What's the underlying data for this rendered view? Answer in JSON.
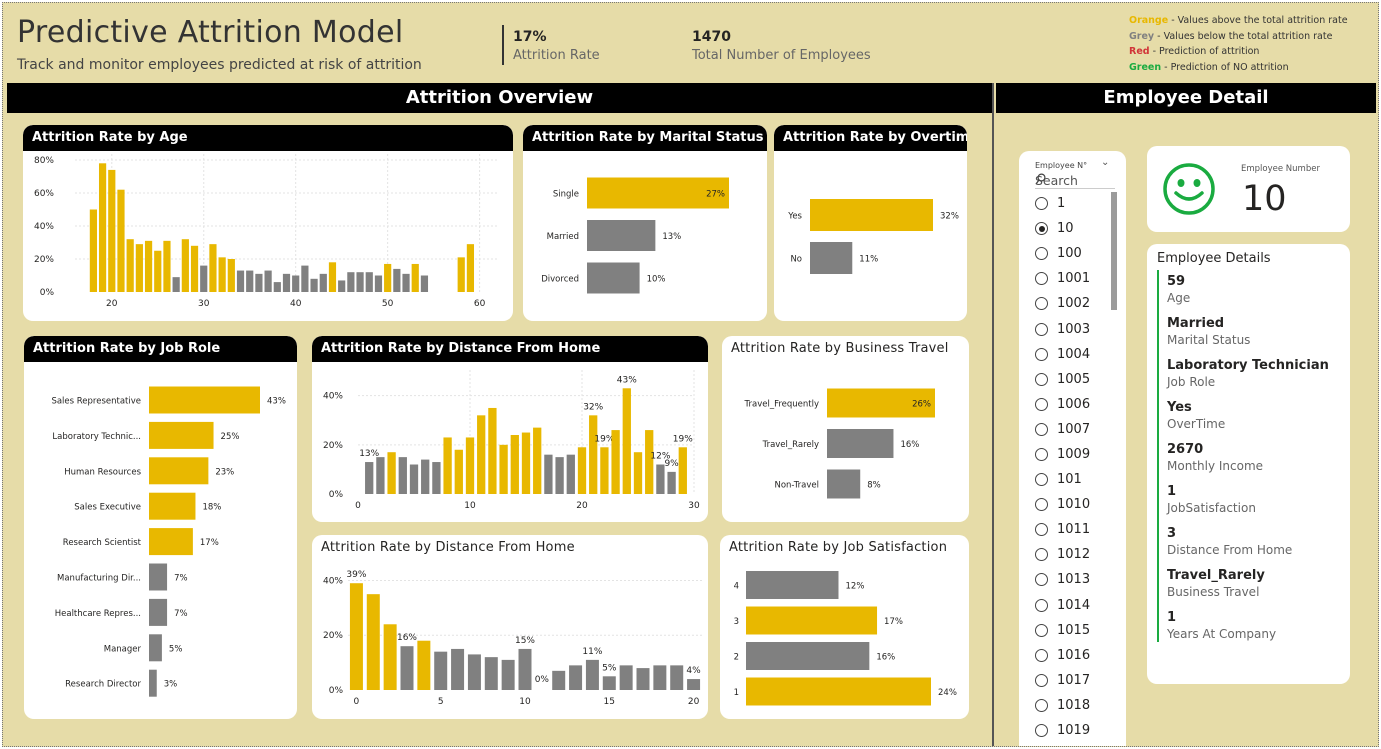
{
  "header": {
    "title": "Predictive Attrition Model",
    "subtitle": "Track and monitor employees predicted at risk of attrition",
    "kpis": [
      {
        "value": "17%",
        "label": "Attrition Rate"
      },
      {
        "value": "1470",
        "label": "Total Number of Employees"
      }
    ],
    "legend": [
      {
        "key": "Orange",
        "text": " - Values above the total attrition rate",
        "color": "#e8b800"
      },
      {
        "key": "Grey",
        "text": " - Values below the total attrition rate",
        "color": "#808080"
      },
      {
        "key": "Red",
        "text": " - Prediction of attrition",
        "color": "#d13438"
      },
      {
        "key": "Green",
        "text": " - Prediction of NO attrition",
        "color": "#1aab40"
      }
    ]
  },
  "banners": {
    "overview": "Attrition Overview",
    "detail": "Employee Detail"
  },
  "colors": {
    "above": "#e8b800",
    "below": "#808080",
    "background": "#e6dca8",
    "smiley": "#1aab40"
  },
  "chart_data": [
    {
      "id": "age",
      "type": "bar",
      "title": "Attrition Rate by Age",
      "x": [
        18,
        19,
        20,
        21,
        22,
        23,
        24,
        25,
        26,
        27,
        28,
        29,
        30,
        31,
        32,
        33,
        34,
        35,
        36,
        37,
        38,
        39,
        40,
        41,
        42,
        43,
        44,
        45,
        46,
        47,
        48,
        49,
        50,
        51,
        52,
        53,
        54,
        55,
        56,
        57,
        58,
        59,
        60
      ],
      "values": [
        50,
        78,
        74,
        62,
        32,
        29,
        31,
        25,
        31,
        9,
        32,
        28,
        16,
        29,
        21,
        20,
        13,
        13,
        11,
        13,
        6,
        11,
        10,
        16,
        8,
        11,
        18,
        7,
        12,
        12,
        12,
        10,
        17,
        14,
        11,
        17,
        10,
        0,
        0,
        0,
        21,
        29,
        0
      ],
      "above": [
        1,
        1,
        1,
        1,
        1,
        1,
        1,
        1,
        1,
        0,
        1,
        1,
        0,
        1,
        1,
        1,
        0,
        0,
        0,
        0,
        0,
        0,
        0,
        0,
        0,
        0,
        1,
        0,
        0,
        0,
        0,
        0,
        1,
        0,
        0,
        1,
        0,
        0,
        0,
        0,
        1,
        1,
        0
      ],
      "yticks": [
        "80%",
        "60%",
        "40%",
        "20%",
        "0%"
      ],
      "xticks": [
        "20",
        "30",
        "40",
        "50",
        "60"
      ],
      "ylim": [
        0,
        80
      ],
      "xlim": [
        16,
        62
      ]
    },
    {
      "id": "marital",
      "type": "bar",
      "orientation": "horizontal",
      "title": "Attrition Rate by Marital Status",
      "categories": [
        "Single",
        "Married",
        "Divorced"
      ],
      "values": [
        27,
        13,
        10
      ],
      "labels": [
        "27%",
        "13%",
        "10%"
      ],
      "above": [
        1,
        0,
        0
      ]
    },
    {
      "id": "overtime",
      "type": "bar",
      "orientation": "horizontal",
      "title": "Attrition Rate by Overtime",
      "categories": [
        "Yes",
        "No"
      ],
      "values": [
        32,
        11
      ],
      "labels": [
        "32%",
        "11%"
      ],
      "above": [
        1,
        0
      ]
    },
    {
      "id": "jobrole",
      "type": "bar",
      "orientation": "horizontal",
      "title": "Attrition Rate by Job Role",
      "categories": [
        "Sales Representative",
        "Laboratory Technic...",
        "Human Resources",
        "Sales Executive",
        "Research Scientist",
        "Manufacturing Dir...",
        "Healthcare Repres...",
        "Manager",
        "Research Director"
      ],
      "values": [
        43,
        25,
        23,
        18,
        17,
        7,
        7,
        5,
        3
      ],
      "labels": [
        "43%",
        "25%",
        "23%",
        "18%",
        "17%",
        "7%",
        "7%",
        "5%",
        "3%"
      ],
      "above": [
        1,
        1,
        1,
        1,
        1,
        0,
        0,
        0,
        0
      ]
    },
    {
      "id": "distance1",
      "type": "bar",
      "title": "Attrition Rate by Distance From Home",
      "x": [
        1,
        2,
        3,
        4,
        5,
        6,
        7,
        8,
        9,
        10,
        11,
        12,
        13,
        14,
        15,
        16,
        17,
        18,
        19,
        20,
        21,
        22,
        23,
        24,
        25,
        26,
        27,
        28,
        29
      ],
      "values": [
        13,
        15,
        17,
        15,
        12,
        14,
        13,
        23,
        18,
        23,
        32,
        35,
        20,
        24,
        25,
        27,
        16,
        15,
        16,
        19,
        32,
        19,
        26,
        43,
        17,
        26,
        12,
        9,
        19
      ],
      "above": [
        0,
        0,
        1,
        0,
        0,
        0,
        0,
        1,
        1,
        1,
        1,
        1,
        1,
        1,
        1,
        1,
        0,
        0,
        0,
        1,
        1,
        1,
        1,
        1,
        1,
        1,
        0,
        0,
        1
      ],
      "point_labels": {
        "1": "13%",
        "21": "32%",
        "22": "19%",
        "24": "43%",
        "27": "12%",
        "28": "9%",
        "29": "19%"
      },
      "yticks": [
        "40%",
        "20%",
        "0%"
      ],
      "xticks": [
        "0",
        "10",
        "20",
        "30"
      ],
      "ylim": [
        0,
        48
      ],
      "xlim": [
        0,
        30
      ]
    },
    {
      "id": "distance2",
      "type": "bar",
      "title": "Attrition Rate by Distance From Home",
      "x": [
        0,
        1,
        2,
        3,
        4,
        5,
        6,
        7,
        8,
        9,
        10,
        11,
        12,
        13,
        14,
        15,
        16,
        17,
        18,
        19,
        20
      ],
      "values": [
        39,
        35,
        24,
        16,
        18,
        14,
        15,
        13,
        12,
        11,
        15,
        0,
        7,
        9,
        11,
        5,
        9,
        8,
        9,
        9,
        4
      ],
      "above": [
        1,
        1,
        1,
        0,
        1,
        0,
        0,
        0,
        0,
        0,
        0,
        0,
        0,
        0,
        0,
        0,
        0,
        0,
        0,
        0,
        0
      ],
      "point_labels": {
        "0": "39%",
        "3": "16%",
        "10": "15%",
        "11": "0%",
        "14": "11%",
        "15": "5%",
        "20": "4%"
      },
      "yticks": [
        "40%",
        "20%",
        "0%"
      ],
      "xticks": [
        "0",
        "5",
        "10",
        "15",
        "20"
      ],
      "ylim": [
        0,
        42
      ],
      "xlim": [
        -0.5,
        20.5
      ]
    },
    {
      "id": "travel",
      "type": "bar",
      "orientation": "horizontal",
      "title": "Attrition Rate by Business Travel",
      "categories": [
        "Travel_Frequently",
        "Travel_Rarely",
        "Non-Travel"
      ],
      "values": [
        26,
        16,
        8
      ],
      "labels": [
        "26%",
        "16%",
        "8%"
      ],
      "above": [
        1,
        0,
        0
      ]
    },
    {
      "id": "jobsat",
      "type": "bar",
      "orientation": "horizontal",
      "title": "Attrition Rate by Job Satisfaction",
      "categories": [
        "4",
        "3",
        "2",
        "1"
      ],
      "values": [
        12,
        17,
        16,
        24
      ],
      "labels": [
        "12%",
        "17%",
        "16%",
        "24%"
      ],
      "above": [
        0,
        1,
        0,
        1
      ]
    }
  ],
  "slicer": {
    "title": "Employee N°",
    "search_placeholder": "Search",
    "selected": "10",
    "items": [
      "1",
      "10",
      "100",
      "1001",
      "1002",
      "1003",
      "1004",
      "1005",
      "1006",
      "1007",
      "1009",
      "101",
      "1010",
      "1011",
      "1012",
      "1013",
      "1014",
      "1015",
      "1016",
      "1017",
      "1018",
      "1019"
    ]
  },
  "employee": {
    "number_label": "Employee Number",
    "number": "10",
    "details_title": "Employee Details",
    "details": [
      {
        "value": "59",
        "label": "Age"
      },
      {
        "value": "Married",
        "label": "Marital Status"
      },
      {
        "value": "Laboratory Technician",
        "label": "Job Role"
      },
      {
        "value": "Yes",
        "label": "OverTime"
      },
      {
        "value": "2670",
        "label": "Monthly Income"
      },
      {
        "value": "1",
        "label": "JobSatisfaction"
      },
      {
        "value": "3",
        "label": "Distance From Home"
      },
      {
        "value": "Travel_Rarely",
        "label": "Business Travel"
      },
      {
        "value": "1",
        "label": "Years At Company"
      }
    ]
  }
}
